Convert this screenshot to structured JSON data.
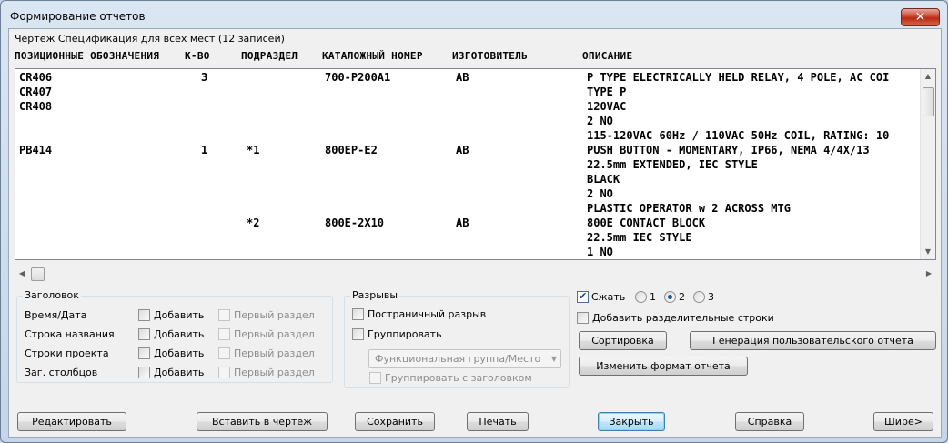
{
  "window": {
    "title": "Формирование отчетов",
    "close_glyph": "✕"
  },
  "subtitle": "Чертеж Спецификация для всех мест (12 записей)",
  "columns": [
    "ПОЗИЦИОННЫЕ ОБОЗНАЧЕНИЯ",
    "К-ВО",
    "ПОДРАЗДЕЛ",
    "КАТАЛОЖНЫЙ НОМЕР",
    "ИЗГОТОВИТЕЛЬ",
    "ОПИСАНИЕ"
  ],
  "rows": [
    [
      "CR406",
      "3",
      "",
      "700-P200A1",
      "AB",
      "P TYPE ELECTRICALLY HELD RELAY, 4 POLE, AC COI"
    ],
    [
      "CR407",
      "",
      "",
      "",
      "",
      "TYPE P"
    ],
    [
      "CR408",
      "",
      "",
      "",
      "",
      "120VAC"
    ],
    [
      "",
      "",
      "",
      "",
      "",
      "2 NO"
    ],
    [
      "",
      "",
      "",
      "",
      "",
      "115-120VAC 60Hz / 110VAC 50Hz COIL, RATING: 10"
    ],
    [
      "PB414",
      "1",
      "*1",
      "800EP-E2",
      "AB",
      "PUSH BUTTON - MOMENTARY, IP66, NEMA 4/4X/13"
    ],
    [
      "",
      "",
      "",
      "",
      "",
      "22.5mm EXTENDED, IEC STYLE"
    ],
    [
      "",
      "",
      "",
      "",
      "",
      "BLACK"
    ],
    [
      "",
      "",
      "",
      "",
      "",
      "2 NO"
    ],
    [
      "",
      "",
      "",
      "",
      "",
      "PLASTIC OPERATOR w 2 ACROSS MTG"
    ],
    [
      "",
      "",
      "*2",
      "800E-2X10",
      "AB",
      "800E CONTACT BLOCK"
    ],
    [
      "",
      "",
      "",
      "",
      "",
      "22.5mm IEC STYLE"
    ],
    [
      "",
      "",
      "",
      "",
      "",
      "1 NO"
    ]
  ],
  "header_group": {
    "label": "Заголовок",
    "items": [
      {
        "label": "Время/Дата",
        "add": "Добавить",
        "first": "Первый раздел"
      },
      {
        "label": "Строка названия",
        "add": "Добавить",
        "first": "Первый раздел"
      },
      {
        "label": "Строки проекта",
        "add": "Добавить",
        "first": "Первый раздел"
      },
      {
        "label": "Заг. столбцов",
        "add": "Добавить",
        "first": "Первый раздел"
      }
    ]
  },
  "breaks_group": {
    "label": "Разрывы",
    "page_break": "Постраничный разрыв",
    "group": "Группировать",
    "group_select": "Функциональная группа/Место",
    "group_with_header": "Группировать с заголовком"
  },
  "options": {
    "compress": "Сжать",
    "radio_labels": [
      "1",
      "2",
      "3"
    ],
    "selected_radio": "2",
    "add_separators": "Добавить разделительные строки",
    "sort": "Сортировка",
    "custom_report": "Генерация пользовательского отчета",
    "change_format": "Изменить формат отчета"
  },
  "buttons": {
    "edit": "Редактировать",
    "insert": "Вставить в чертеж",
    "save": "Сохранить",
    "print": "Печать",
    "close": "Закрыть",
    "help": "Справка",
    "wider": "Шире>"
  },
  "colors": {
    "title_bar": "#c6d5e8",
    "close_red": "#c9452f",
    "default_button": "#3c7fb1"
  }
}
